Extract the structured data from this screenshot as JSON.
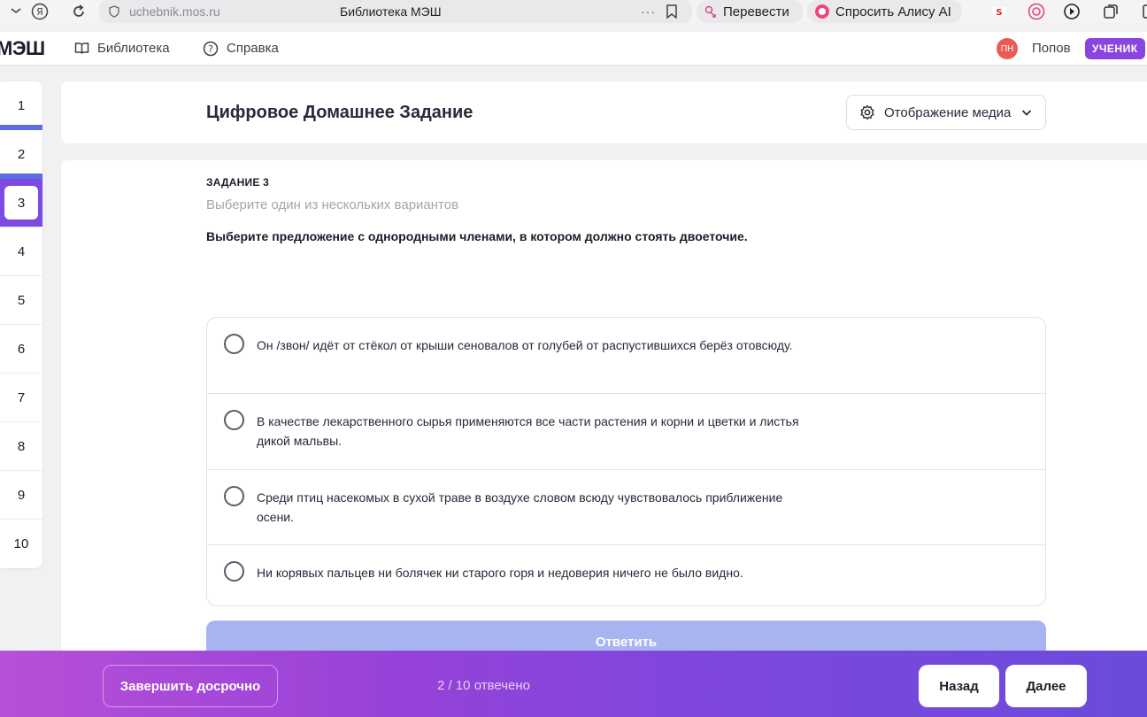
{
  "browser": {
    "url": "uchebnik.mos.ru",
    "tab_title": "Библиотека МЭШ",
    "more": "···",
    "translate_label": "Перевести",
    "alice_label": "Спросить Алису AI"
  },
  "header": {
    "logo": "МЭШ",
    "library_label": "Библиотека",
    "help_label": "Справка",
    "avatar_initials": "ПН",
    "user_name": "Попов",
    "role_badge": "УЧЕНИК"
  },
  "tasks": {
    "numbers": [
      "1",
      "2",
      "3",
      "4",
      "5",
      "6",
      "7",
      "8",
      "9",
      "10"
    ],
    "current": "3"
  },
  "page": {
    "title": "Цифровое Домашнее Задание",
    "media_button": "Отображение медиа"
  },
  "task": {
    "label": "ЗАДАНИЕ 3",
    "hint": "Выберите один из нескольких вариантов",
    "question": "Выберите предложение с однородными членами, в котором должно стоять двоеточие.",
    "options": [
      "Он /звон/ идёт от стёкол от крыши сеновалов от голубей от распустившихся берёз отовсюду.",
      "В качестве лекарственного сырья применяются все части растения и корни и цветки и листья дикой мальвы.",
      "Среди птиц насекомых в сухой траве в воздухе словом всюду чувствовалось приближение осени.",
      "Ни корявых пальцев ни болячек ни старого горя и недоверия ничего не было видно."
    ],
    "submit_label": "Ответить"
  },
  "footer": {
    "finish_label": "Завершить досрочно",
    "progress": "2 / 10 отвечено",
    "back_label": "Назад",
    "next_label": "Далее"
  },
  "colors": {
    "accent": "#7d4be0",
    "answered_bar": "#5b6ee8",
    "submit_disabled": "#a8b4f0",
    "avatar": "#ea5b56"
  }
}
